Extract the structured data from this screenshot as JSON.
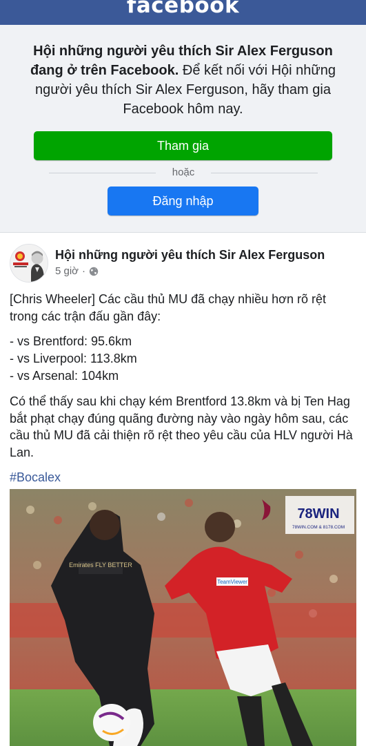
{
  "header": {
    "logo_text": "facebook"
  },
  "join": {
    "invite_bold": "Hội những người yêu thích Sir Alex Ferguson đang ở trên Facebook.",
    "invite_rest": " Để kết nối với Hội những người yêu thích Sir Alex Ferguson, hãy tham gia Facebook hôm nay.",
    "join_label": "Tham gia",
    "or_label": "hoặc",
    "login_label": "Đăng nhập"
  },
  "post": {
    "page_name": "Hội những người yêu thích Sir Alex Ferguson",
    "time": "5 giờ",
    "separator": "·",
    "paragraph1": "[Chris Wheeler] Các cầu thủ MU đã chạy nhiều hơn rõ rệt trong các trận đấu gần đây:",
    "stats": [
      "- vs Brentford: 95.6km",
      "- vs Liverpool: 113.8km",
      "- vs Arsenal: 104km"
    ],
    "paragraph2": "Có thể thấy sau khi chạy kém Brentford 13.8km và bị Ten Hag bắt phạt chạy đúng quãng đường này vào ngày hôm sau, các cầu thủ MU đã cải thiện rõ rệt theo yêu cầu của HLV người Hà Lan.",
    "hashtag": "#Bocalex",
    "image": {
      "watermark_brand": "78WIN",
      "watermark_url": "78WIN.COM & 8178.COM",
      "jersey_sponsor_left": "Emirates FLY BETTER",
      "jersey_sponsor_right": "TeamViewer"
    }
  },
  "colors": {
    "brand_blue": "#3b5998",
    "join_green": "#00a400",
    "login_blue": "#1877f2",
    "hashtag": "#385898",
    "panel_bg": "#f0f2f5"
  }
}
